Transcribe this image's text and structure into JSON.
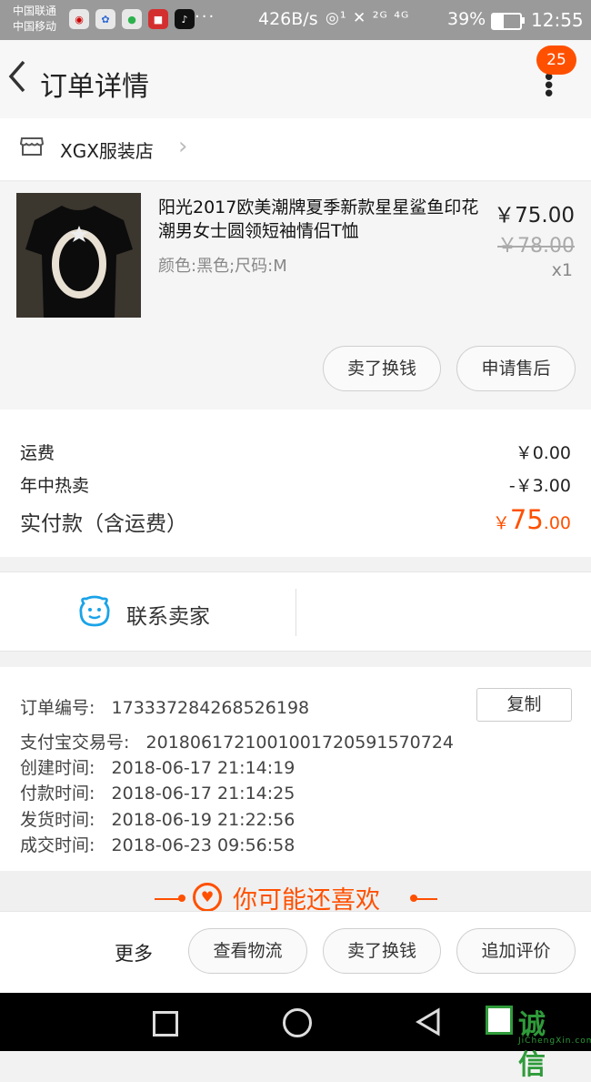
{
  "status_bar": {
    "carrier_1": "中国联通",
    "carrier_2": "中国移动",
    "app_icons": [
      "weibo-icon",
      "baidu-icon",
      "wechat-icon",
      "app-icon",
      "tiktok-icon"
    ],
    "more": "···",
    "speed": "426B/s",
    "signal_text": "◎¹ ✕ ²ᴳ ⁴ᴳ",
    "battery_percent": "39%",
    "battery_level": 0.39,
    "time": "12:55"
  },
  "header": {
    "title": "订单详情",
    "badge": "25"
  },
  "shop": {
    "name": "XGX服装店"
  },
  "product": {
    "name": "阳光2017欧美潮牌夏季新款星星鲨鱼印花潮男女士圆领短袖情侣T恤",
    "sku": "颜色:黑色;尺码:M",
    "price": "￥75.00",
    "original_price": "￥78.00",
    "quantity": "x1",
    "buttons": {
      "sell": "卖了换钱",
      "after_sale": "申请售后"
    }
  },
  "fees": {
    "shipping_label": "运费",
    "shipping_value": "￥0.00",
    "discount_label": "年中热卖",
    "discount_value": "-￥3.00",
    "paid_label": "实付款（含运费）",
    "paid_symbol": "￥",
    "paid_int": "75",
    "paid_dec": ".00"
  },
  "contact": {
    "label": "联系卖家"
  },
  "order_info": {
    "copy_label": "复制",
    "rows": [
      {
        "label": "订单编号:",
        "value": "173337284268526198"
      },
      {
        "label": "支付宝交易号:",
        "value": "2018061721001001720591570724"
      },
      {
        "label": "创建时间:",
        "value": "2018-06-17 21:14:19"
      },
      {
        "label": "付款时间:",
        "value": "2018-06-17 21:14:25"
      },
      {
        "label": "发货时间:",
        "value": "2018-06-19 21:22:56"
      },
      {
        "label": "成交时间:",
        "value": "2018-06-23 09:56:58"
      }
    ]
  },
  "recommend": {
    "title": "你可能还喜欢"
  },
  "actions": {
    "more": "更多",
    "logistics": "查看物流",
    "sell": "卖了换钱",
    "review": "追加评价"
  },
  "watermark": {
    "text": "诚信",
    "sub": "JiChengXin.com"
  },
  "colors": {
    "accent": "#ff5000",
    "contact_blue": "#1aa3e8"
  }
}
